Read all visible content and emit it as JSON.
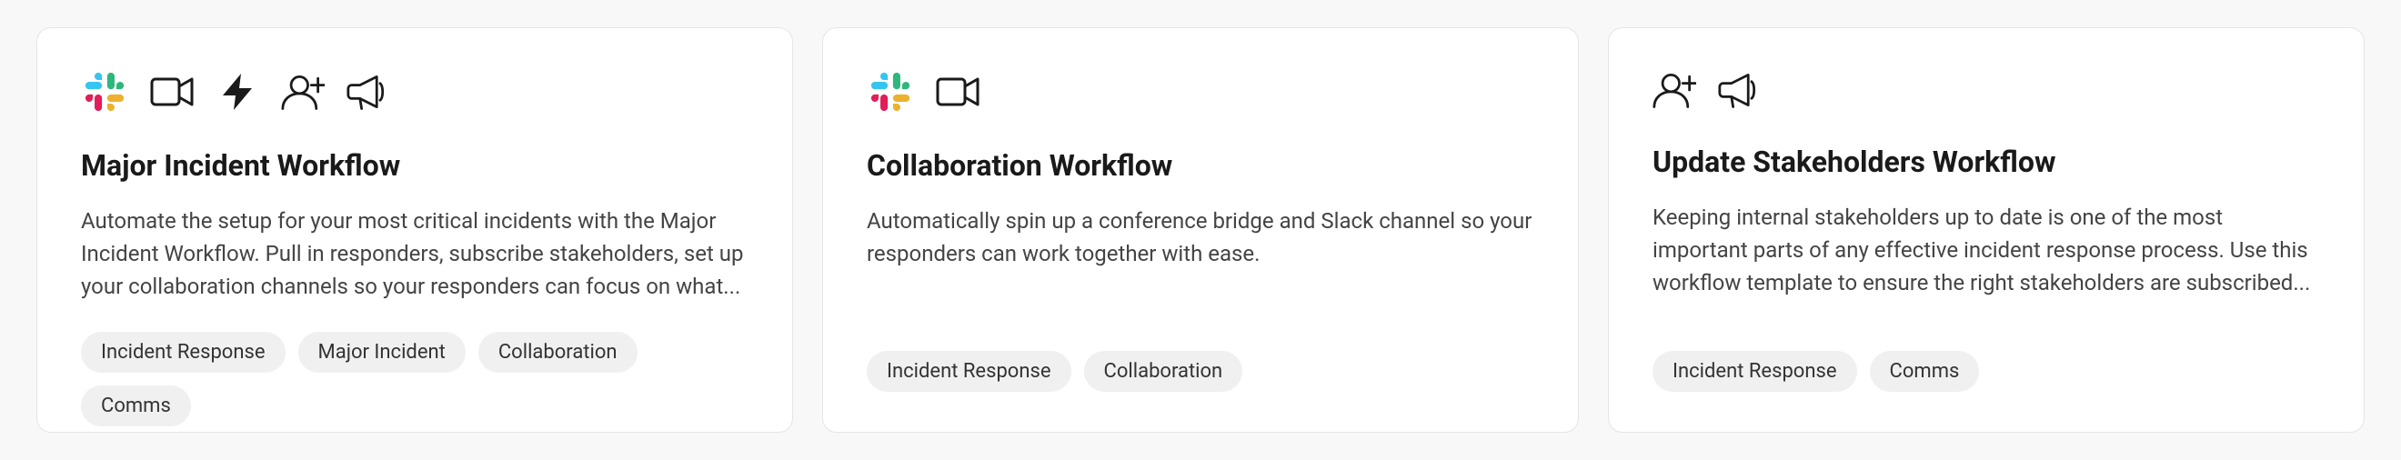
{
  "cards": [
    {
      "id": "major-incident",
      "title": "Major Incident Workflow",
      "description": "Automate the setup for your most critical incidents with the Major Incident Workflow. Pull in responders, subscribe stakeholders, set up your collaboration channels so your responders can focus on what...",
      "icons": [
        "slack",
        "video",
        "bolt",
        "add-user",
        "megaphone"
      ],
      "tags": [
        "Incident Response",
        "Major Incident",
        "Collaboration",
        "Comms"
      ]
    },
    {
      "id": "collaboration",
      "title": "Collaboration Workflow",
      "description": "Automatically spin up a conference bridge and Slack channel so your responders can work together with ease.",
      "icons": [
        "slack",
        "video"
      ],
      "tags": [
        "Incident Response",
        "Collaboration"
      ]
    },
    {
      "id": "update-stakeholders",
      "title": "Update Stakeholders Workflow",
      "description": "Keeping internal stakeholders up to date is one of the most important parts of any effective incident response process. Use this workflow template to ensure the right stakeholders are subscribed...",
      "icons": [
        "add-user",
        "megaphone"
      ],
      "tags": [
        "Incident Response",
        "Comms"
      ]
    }
  ]
}
